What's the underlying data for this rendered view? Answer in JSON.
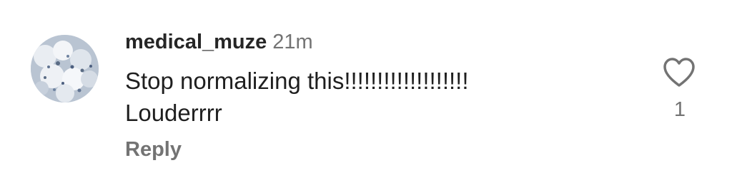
{
  "comment": {
    "username": "medical_muze",
    "timestamp": "21m",
    "text_line_1": "Stop normalizing this!!!!!!!!!!!!!!!!!!!",
    "text_line_2": "Louderrrr",
    "reply_label": "Reply",
    "like_count": "1",
    "avatar": "flowers-avatar-image",
    "like_icon": "heart-outline-icon"
  },
  "colors": {
    "username": "#262626",
    "secondary_text": "#737373",
    "icon_stroke": "#737373",
    "background": "#ffffff"
  }
}
